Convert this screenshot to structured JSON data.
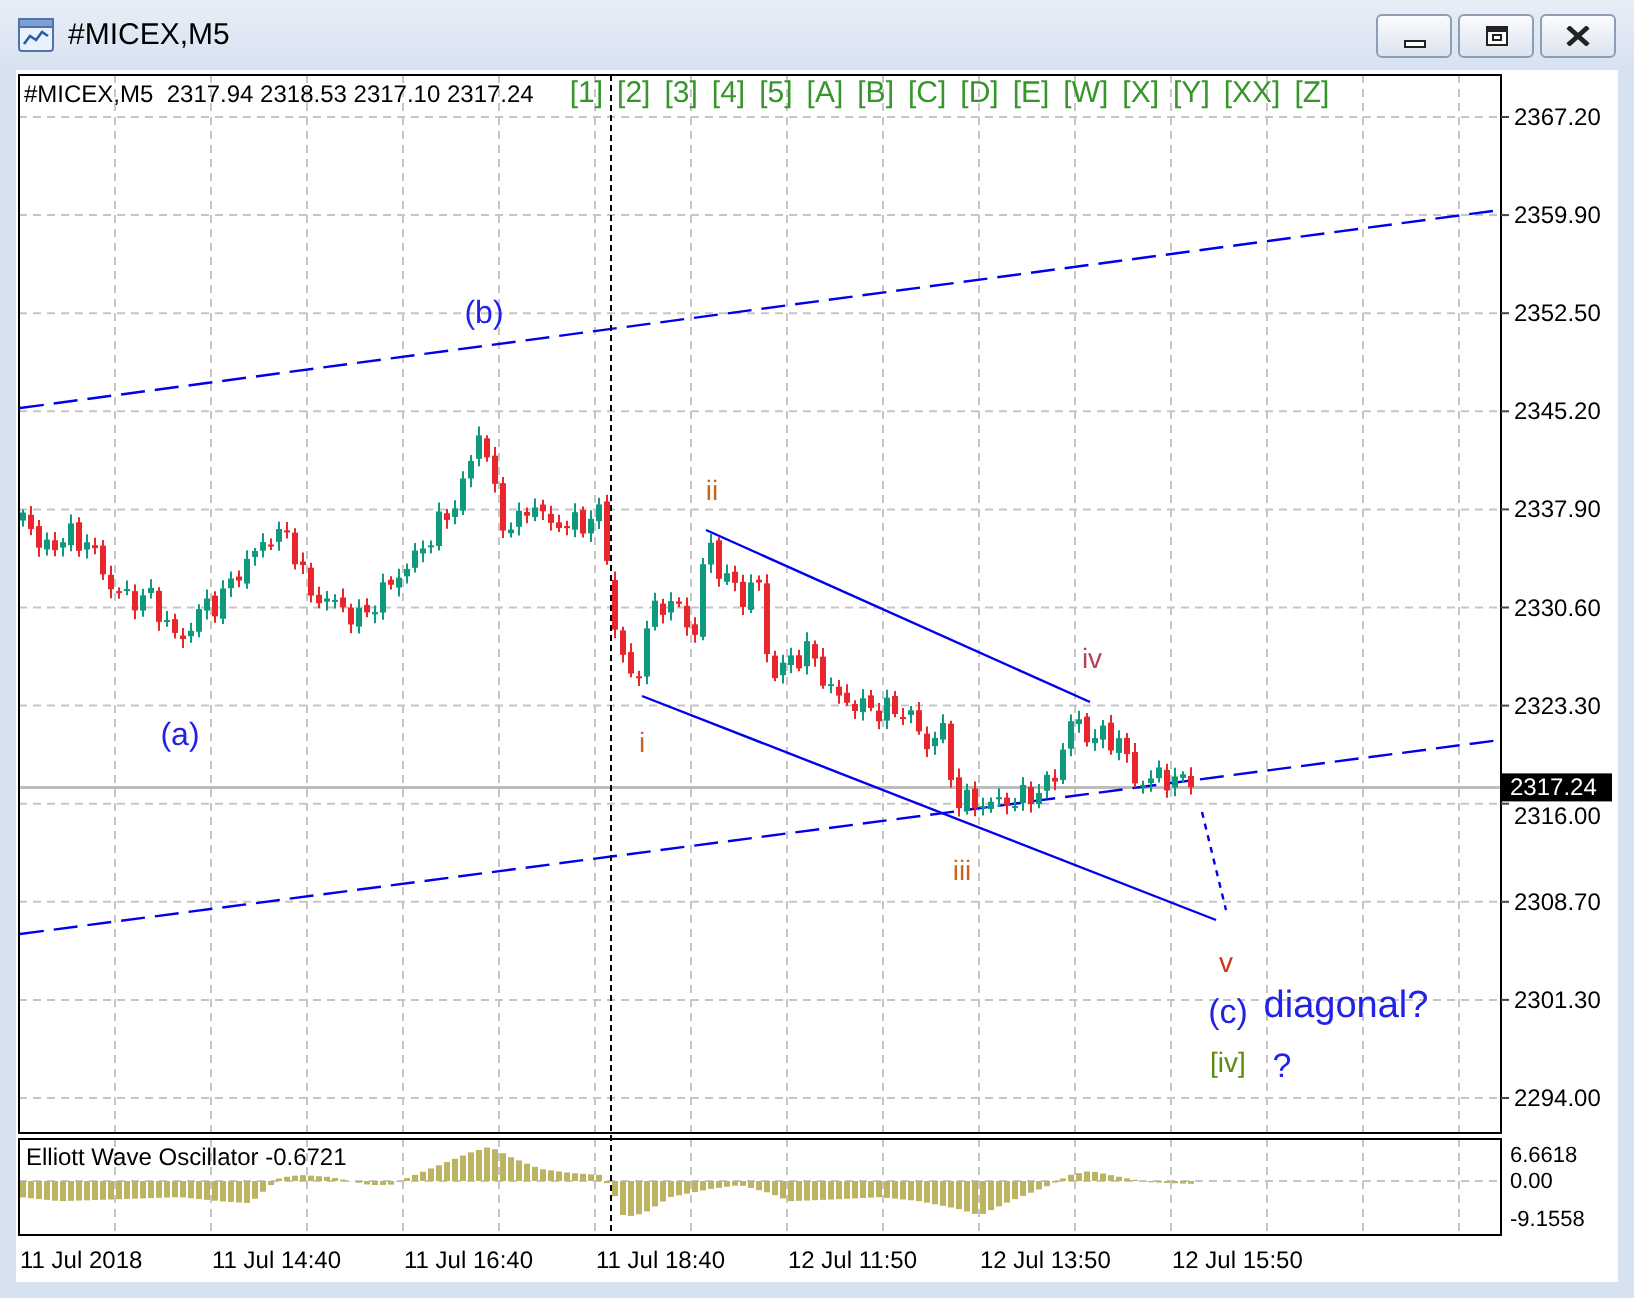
{
  "window": {
    "title": "#MICEX,M5",
    "buttons": [
      {
        "kind": "minimize"
      },
      {
        "kind": "restore"
      },
      {
        "kind": "close"
      }
    ]
  },
  "price_chart": {
    "quote_info": "#MICEX,M5  2317.94 2318.53 2317.10 2317.24",
    "wave_buttons": [
      "[1]",
      "[2]",
      "[3]",
      "[4]",
      "[5]",
      "[A]",
      "[B]",
      "[C]",
      "[D]",
      "[E]",
      "[W]",
      "[X]",
      "[Y]",
      "[XX]",
      "[Z]"
    ],
    "annotations": [
      {
        "text": "(b)",
        "color": "#2222e6"
      },
      {
        "text": "(a)",
        "color": "#2222e6"
      },
      {
        "text": "i",
        "color": "#c8641e"
      },
      {
        "text": "ii",
        "color": "#c8641e"
      },
      {
        "text": "iii",
        "color": "#c8641e"
      },
      {
        "text": "iv",
        "color": "#b8405a"
      },
      {
        "text": "v",
        "color": "#cc3322"
      },
      {
        "text": "(c)",
        "color": "#2222e6"
      },
      {
        "text": "diagonal?",
        "color": "#2222e6"
      },
      {
        "text": "[iv]",
        "color": "#5a8c14"
      },
      {
        "text": "?",
        "color": "#2222e6"
      }
    ],
    "price_axis": {
      "ticks": [
        "2367.20",
        "2359.90",
        "2352.50",
        "2345.20",
        "2337.90",
        "2330.60",
        "2323.30",
        "2316.00",
        "2308.70",
        "2301.30",
        "2294.00"
      ],
      "current_price": "2317.24"
    }
  },
  "oscillator": {
    "title": "Elliott Wave Oscillator -0.6721",
    "ticks": [
      "6.6618",
      "0.00",
      "-9.1558"
    ]
  },
  "time_axis": {
    "labels": [
      "11 Jul 2018",
      "11 Jul 14:40",
      "11 Jul 16:40",
      "11 Jul 18:40",
      "12 Jul 11:50",
      "12 Jul 13:50",
      "12 Jul 15:50"
    ]
  }
}
